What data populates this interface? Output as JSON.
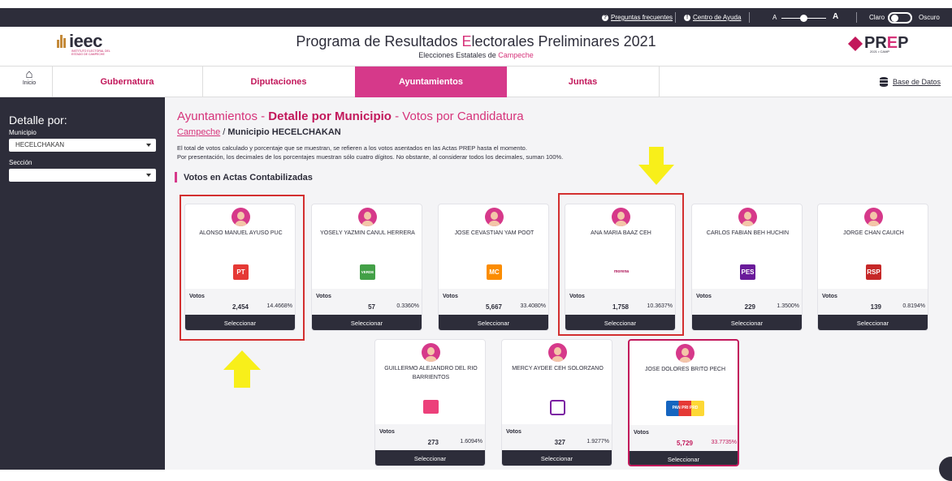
{
  "topbar": {
    "faq": "Preguntas frecuentes",
    "help": "Centro de Ayuda",
    "font_small": "A",
    "font_large": "A",
    "theme_light": "Claro",
    "theme_dark": "Oscuro"
  },
  "header": {
    "logo_text": "ieec",
    "logo_sub": "INSTITUTO ELECTORAL DEL ESTADO DE CAMPECHE",
    "title_pre": "Programa de Resultados ",
    "title_accent": "E",
    "title_post": "lectorales Preliminares 2021",
    "subtitle_pre": "Elecciones Estatales de ",
    "subtitle_accent": "Campeche",
    "prep_a": "PR",
    "prep_b": "E",
    "prep_c": "P",
    "prep_sub": "2021 • CAMP"
  },
  "nav": {
    "home": "Inicio",
    "tabs": [
      "Gubernatura",
      "Diputaciones",
      "Ayuntamientos",
      "Juntas"
    ],
    "database": "Base de Datos"
  },
  "sidebar": {
    "title": "Detalle por:",
    "municipio_label": "Municipio",
    "municipio_value": "HECELCHAKAN",
    "seccion_label": "Sección",
    "seccion_value": ""
  },
  "main": {
    "title_a": "Ayuntamientos - ",
    "title_b": "Detalle por Municipio",
    "title_c": " - Votos por Candidatura",
    "breadcrumb_link": "Campeche",
    "breadcrumb_sep": " / ",
    "breadcrumb_current": "Municipio HECELCHAKAN",
    "note1": "El total de votos calculado y porcentaje que se muestran, se refieren a los votos asentados en las Actas PREP hasta el momento.",
    "note2": "Por presentación, los decimales de los porcentajes muestran sólo cuatro dígitos. No obstante, al considerar todos los decimales, suman 100%.",
    "section": "Votos en Actas Contabilizadas",
    "votes_label": "Votos",
    "select_label": "Seleccionar"
  },
  "candidates": [
    {
      "name": "ALONSO MANUEL AYUSO PUC",
      "party": "PT",
      "votes": "2,454",
      "pct": "14.4668%",
      "color": "#e53935"
    },
    {
      "name": "YOSELY YAZMIN CANUL HERRERA",
      "party": "VERDE",
      "votes": "57",
      "pct": "0.3360%",
      "color": "#43a047"
    },
    {
      "name": "JOSE CEVASTIAN YAM POOT",
      "party": "MC",
      "votes": "5,667",
      "pct": "33.4080%",
      "color": "#fb8c00"
    },
    {
      "name": "ANA MARIA BAAZ CEH",
      "party": "morena",
      "votes": "1,758",
      "pct": "10.3637%",
      "color": "#ad1457"
    },
    {
      "name": "CARLOS FABIAN BEH HUCHIN",
      "party": "PES",
      "votes": "229",
      "pct": "1.3500%",
      "color": "#6a1b9a"
    },
    {
      "name": "JORGE CHAN CAUICH",
      "party": "RSP",
      "votes": "139",
      "pct": "0.8194%",
      "color": "#c62828"
    },
    {
      "name": "GUILLERMO ALEJANDRO DEL RIO BARRIENTOS",
      "party": "",
      "votes": "273",
      "pct": "1.6094%",
      "color": "#ec407a"
    },
    {
      "name": "MERCY AYDEE CEH SOLORZANO",
      "party": "",
      "votes": "327",
      "pct": "1.9277%",
      "color": "#7b1fa2"
    },
    {
      "name": "JOSE DOLORES BRITO PECH",
      "party": "PAN PRI PRD",
      "votes": "5,729",
      "pct": "33.7735%",
      "color": "#1565c0"
    }
  ]
}
